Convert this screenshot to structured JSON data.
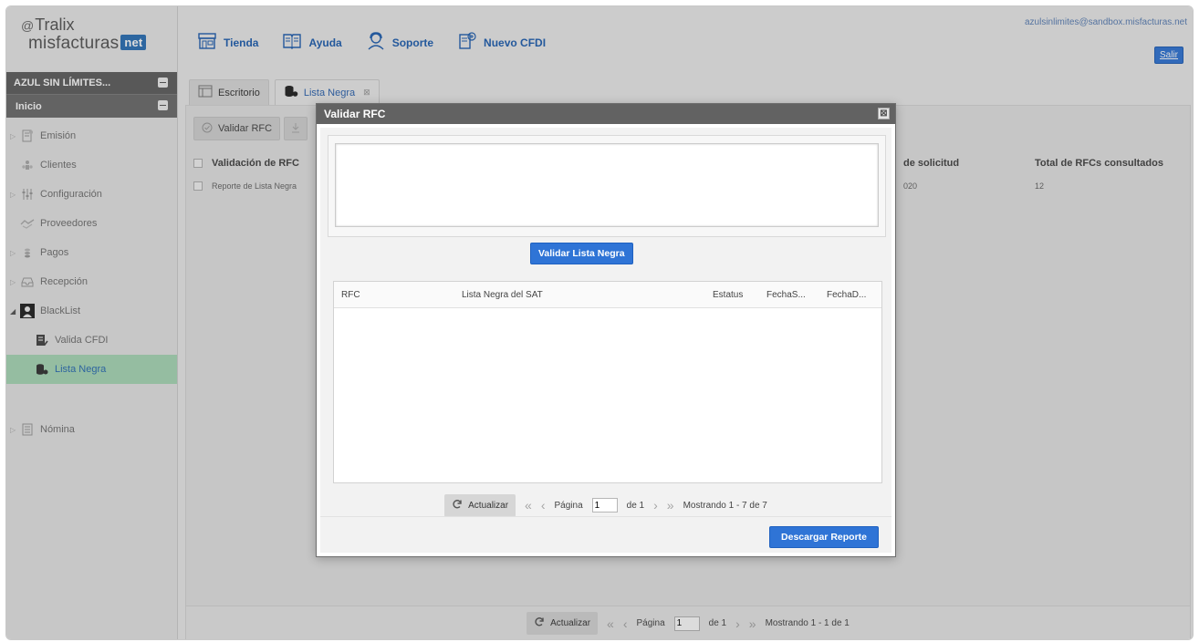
{
  "brand": {
    "line1": "Tralix",
    "line2": "misfacturas",
    "net": "net"
  },
  "sidebar": {
    "company": "AZUL SIN LÍMITES...",
    "section": "Inicio",
    "items": [
      {
        "label": "Emisión",
        "icon": "invoice-icon"
      },
      {
        "label": "Clientes",
        "icon": "users-icon"
      },
      {
        "label": "Configuración",
        "icon": "sliders-icon"
      },
      {
        "label": "Proveedores",
        "icon": "handshake-icon"
      },
      {
        "label": "Pagos",
        "icon": "coins-icon"
      },
      {
        "label": "Recepción",
        "icon": "inbox-icon"
      },
      {
        "label": "BlackList",
        "icon": "blacklist-icon"
      },
      {
        "label": "Valida CFDI",
        "icon": "document-check-icon"
      },
      {
        "label": "Lista Negra",
        "icon": "database-icon"
      },
      {
        "label": "Nómina",
        "icon": "payroll-icon"
      }
    ]
  },
  "topnav": {
    "items": [
      {
        "label": "Tienda",
        "icon": "store-icon"
      },
      {
        "label": "Ayuda",
        "icon": "book-icon"
      },
      {
        "label": "Soporte",
        "icon": "support-icon"
      },
      {
        "label": "Nuevo CFDI",
        "icon": "new-document-icon"
      }
    ],
    "user_email": "azulsinlimites@sandbox.misfacturas.net",
    "logout": "Salir"
  },
  "tabs": [
    {
      "label": "Escritorio"
    },
    {
      "label": "Lista Negra",
      "close": "⊠"
    }
  ],
  "main": {
    "toolbar": {
      "validar": "Validar RFC"
    },
    "columns": {
      "validacion": "Validación de RFC",
      "fecha": "de solicitud",
      "total": "Total de RFCs consultados"
    },
    "row": {
      "name": "Reporte de Lista Negra",
      "fecha": "020",
      "total": "12"
    },
    "pager": {
      "refresh": "Actualizar",
      "page_label": "Página",
      "page_value": "1",
      "of": "de 1",
      "showing": "Mostrando 1 - 1 de 1"
    }
  },
  "modal": {
    "title": "Validar RFC",
    "close": "⊠",
    "validate_button": "Validar Lista Negra",
    "columns": {
      "rfc": "RFC",
      "lista": "Lista Negra del SAT",
      "estatus": "Estatus",
      "fecha_s": "FechaS...",
      "fecha_d": "FechaD..."
    },
    "pager": {
      "refresh": "Actualizar",
      "page_label": "Página",
      "page_value": "1",
      "of": "de 1",
      "showing": "Mostrando 1 - 7 de 7"
    },
    "download_button": "Descargar Reporte"
  },
  "colors": {
    "accent": "#2f74d6",
    "link": "#1e5fb1",
    "active_menu": "#a9d9b7",
    "header_dark": "#626262"
  }
}
